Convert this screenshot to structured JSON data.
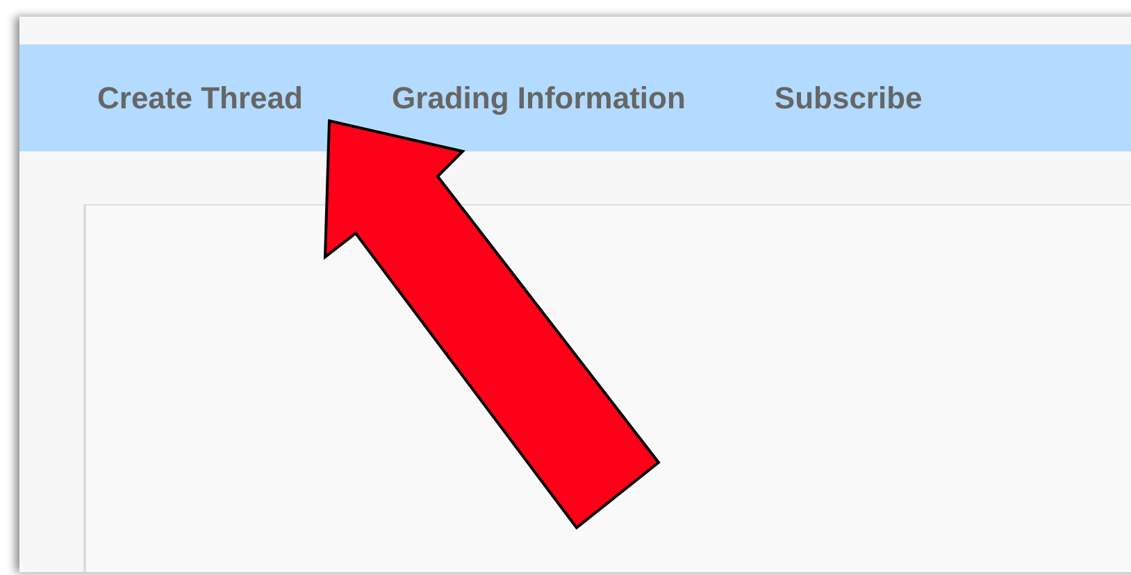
{
  "nav": {
    "items": [
      {
        "label": "Create Thread"
      },
      {
        "label": "Grading Information"
      },
      {
        "label": "Subscribe"
      }
    ]
  }
}
